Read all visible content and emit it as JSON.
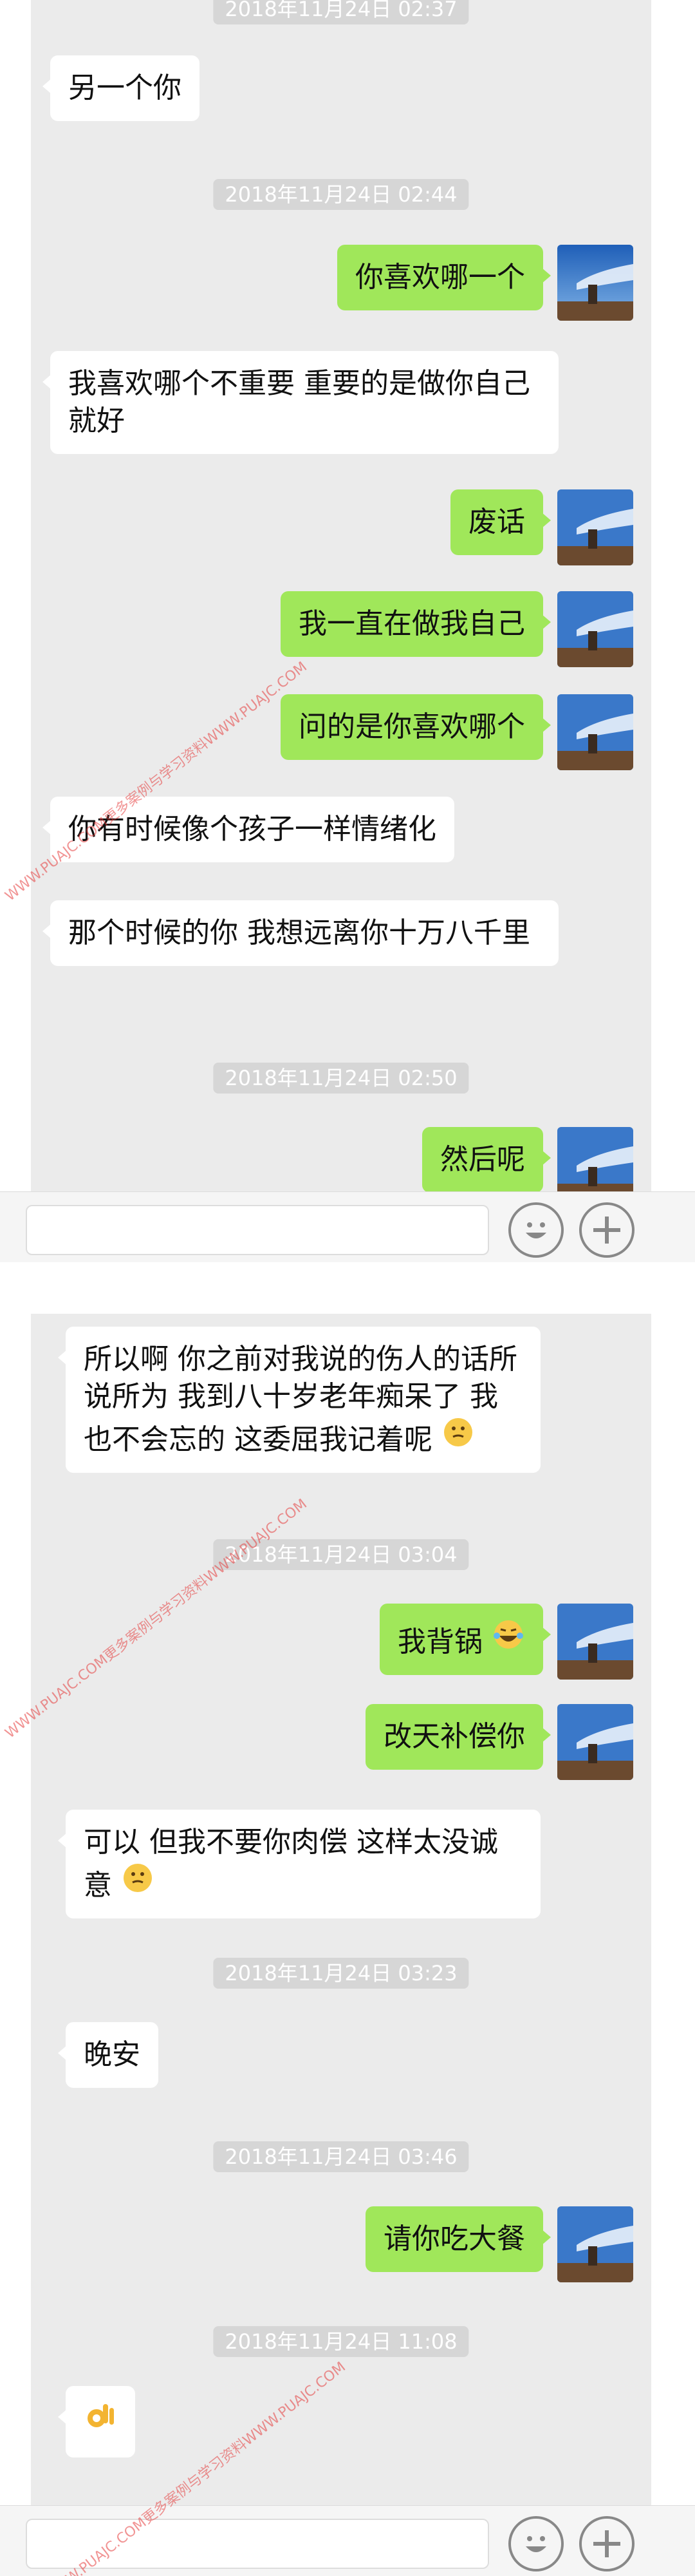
{
  "screen1": {
    "messages": [
      {
        "type": "timestamp",
        "text": "2018年11月24日 02:37"
      },
      {
        "type": "in",
        "text": "另一个你"
      },
      {
        "type": "timestamp",
        "text": "2018年11月24日 02:44"
      },
      {
        "type": "out",
        "text": "你喜欢哪一个"
      },
      {
        "type": "in",
        "text": "我喜欢哪个不重要 重要的是做你自己就好"
      },
      {
        "type": "out",
        "text": "废话"
      },
      {
        "type": "out",
        "text": "我一直在做我自己"
      },
      {
        "type": "out",
        "text": "问的是你喜欢哪个"
      },
      {
        "type": "in",
        "text": "你有时候像个孩子一样情绪化"
      },
      {
        "type": "in",
        "text": "那个时候的你 我想远离你十万八千里"
      },
      {
        "type": "timestamp",
        "text": "2018年11月24日 02:50"
      },
      {
        "type": "out",
        "text": "然后呢"
      }
    ]
  },
  "screen2": {
    "messages": [
      {
        "type": "in",
        "text": "所以啊 你之前对我说的伤人的话所说所为 我到八十岁老年痴呆了 我也不会忘的 这委屈我记着呢"
      },
      {
        "type": "timestamp",
        "text": "2018年11月24日 03:04"
      },
      {
        "type": "out",
        "text": "我背锅"
      },
      {
        "type": "out",
        "text": "改天补偿你"
      },
      {
        "type": "in",
        "text": "可以 但我不要你肉偿 这样太没诚意"
      },
      {
        "type": "timestamp",
        "text": "2018年11月24日 03:23"
      },
      {
        "type": "in",
        "text": "晚安"
      },
      {
        "type": "timestamp",
        "text": "2018年11月24日 03:46"
      },
      {
        "type": "out",
        "text": "请你吃大餐"
      },
      {
        "type": "timestamp",
        "text": "2018年11月24日 11:08"
      }
    ]
  },
  "watermark": "WWW.PUAJC.COM更多案例与学习资料WWW.PUAJC.COM",
  "icons": {
    "emoji_button": "smiley-face-icon",
    "add_button": "plus-icon",
    "thinking_emoji": "thinking-emoji-icon",
    "laughing_emoji": "tears-of-joy-emoji-icon",
    "ok_hand_emoji": "ok-hand-emoji-icon",
    "avatar": "sky-chimney-avatar-image"
  },
  "colors": {
    "chat_bg": "#ebebeb",
    "outgoing_bubble": "#a0e75a",
    "incoming_bubble": "#ffffff",
    "timestamp_bg": "#d6d6d6"
  }
}
